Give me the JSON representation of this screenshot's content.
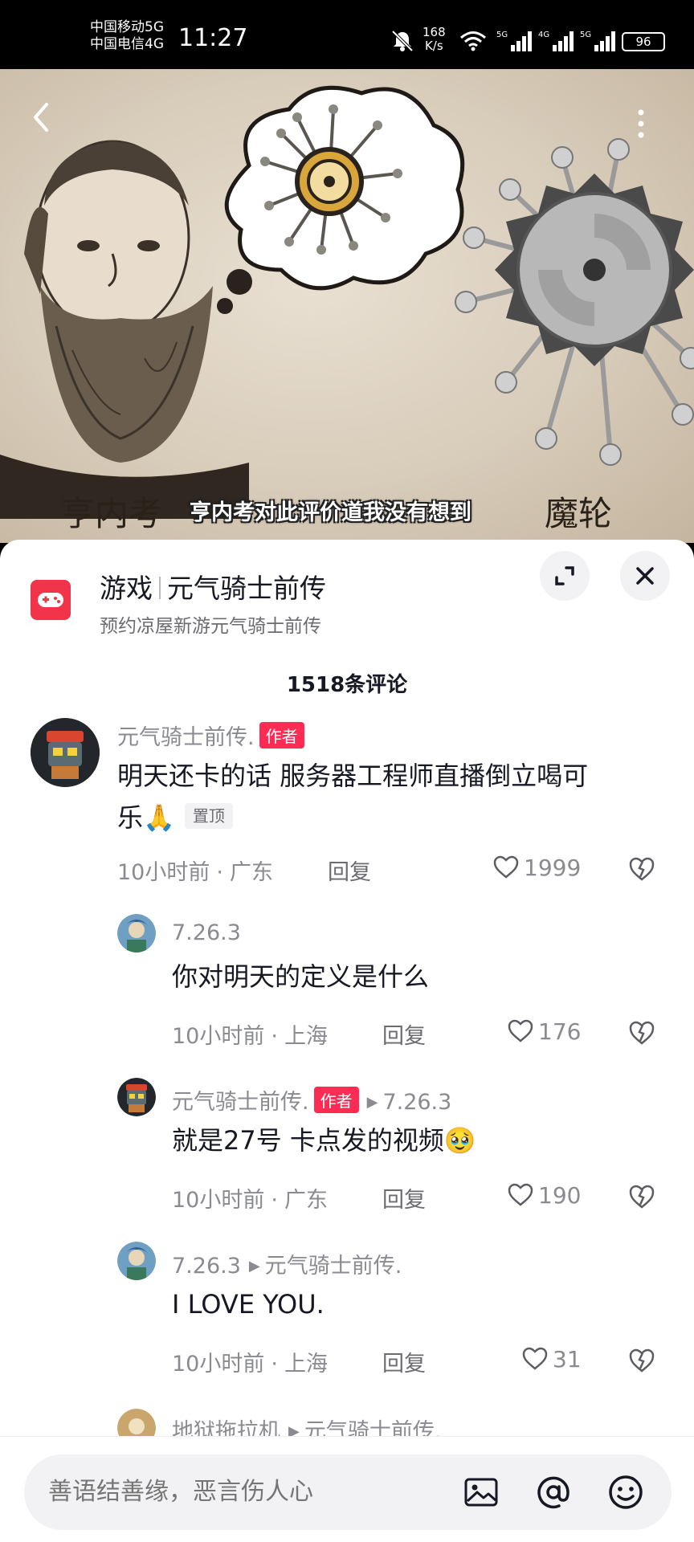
{
  "status_bar": {
    "carrier_1": "中国移动5G",
    "carrier_2": "中国电信4G",
    "time": "11:27",
    "net_speed_value": "168",
    "net_speed_unit": "K/s",
    "battery": "96"
  },
  "video": {
    "label_left": "亨内考",
    "caption": "亨内考对此评价道我没有想到",
    "label_right": "魔轮"
  },
  "ad": {
    "category": "游戏",
    "title": "元气骑士前传",
    "subtitle": "预约凉屋新游元气骑士前传"
  },
  "comments_header": {
    "count_label": "1518条评论"
  },
  "comments": [
    {
      "author": "元气骑士前传.",
      "author_tag": "作者",
      "text": "明天还卡的话 服务器工程师直播倒立喝可乐🙏",
      "text_line1": "明天还卡的话 服务器工程师直播倒立喝可",
      "text_line2": "乐🙏",
      "pinned_tag": "置顶",
      "time": "10小时前",
      "location": "广东",
      "reply_label": "回复",
      "likes": "1999"
    },
    {
      "author": "7.26.3",
      "text": "你对明天的定义是什么",
      "time": "10小时前",
      "location": "上海",
      "reply_label": "回复",
      "likes": "176"
    },
    {
      "author": "元气骑士前传.",
      "author_tag": "作者",
      "reply_to": "7.26.3",
      "text": "就是27号 卡点发的视频🥹",
      "time": "10小时前",
      "location": "广东",
      "reply_label": "回复",
      "likes": "190"
    },
    {
      "author": "7.26.3",
      "reply_to": "元气骑士前传.",
      "text": "I LOVE YOU.",
      "time": "10小时前",
      "location": "上海",
      "reply_label": "回复",
      "likes": "31"
    },
    {
      "author": "地狱拖拉机",
      "reply_to": "元气骑士前传."
    }
  ],
  "input": {
    "placeholder": "善语结善缘，恶言伤人心"
  },
  "colors": {
    "accent_red": "#fe2c55",
    "ad_icon_red": "#f2344a",
    "text_primary": "#161823",
    "text_secondary": "#8a8b91"
  },
  "icons": [
    "back-icon",
    "more-icon",
    "game-controller-icon",
    "expand-icon",
    "close-icon",
    "heart-icon",
    "dislike-heart-icon",
    "image-icon",
    "at-icon",
    "emoji-icon",
    "mute-icon",
    "wifi-icon",
    "signal-icon"
  ]
}
